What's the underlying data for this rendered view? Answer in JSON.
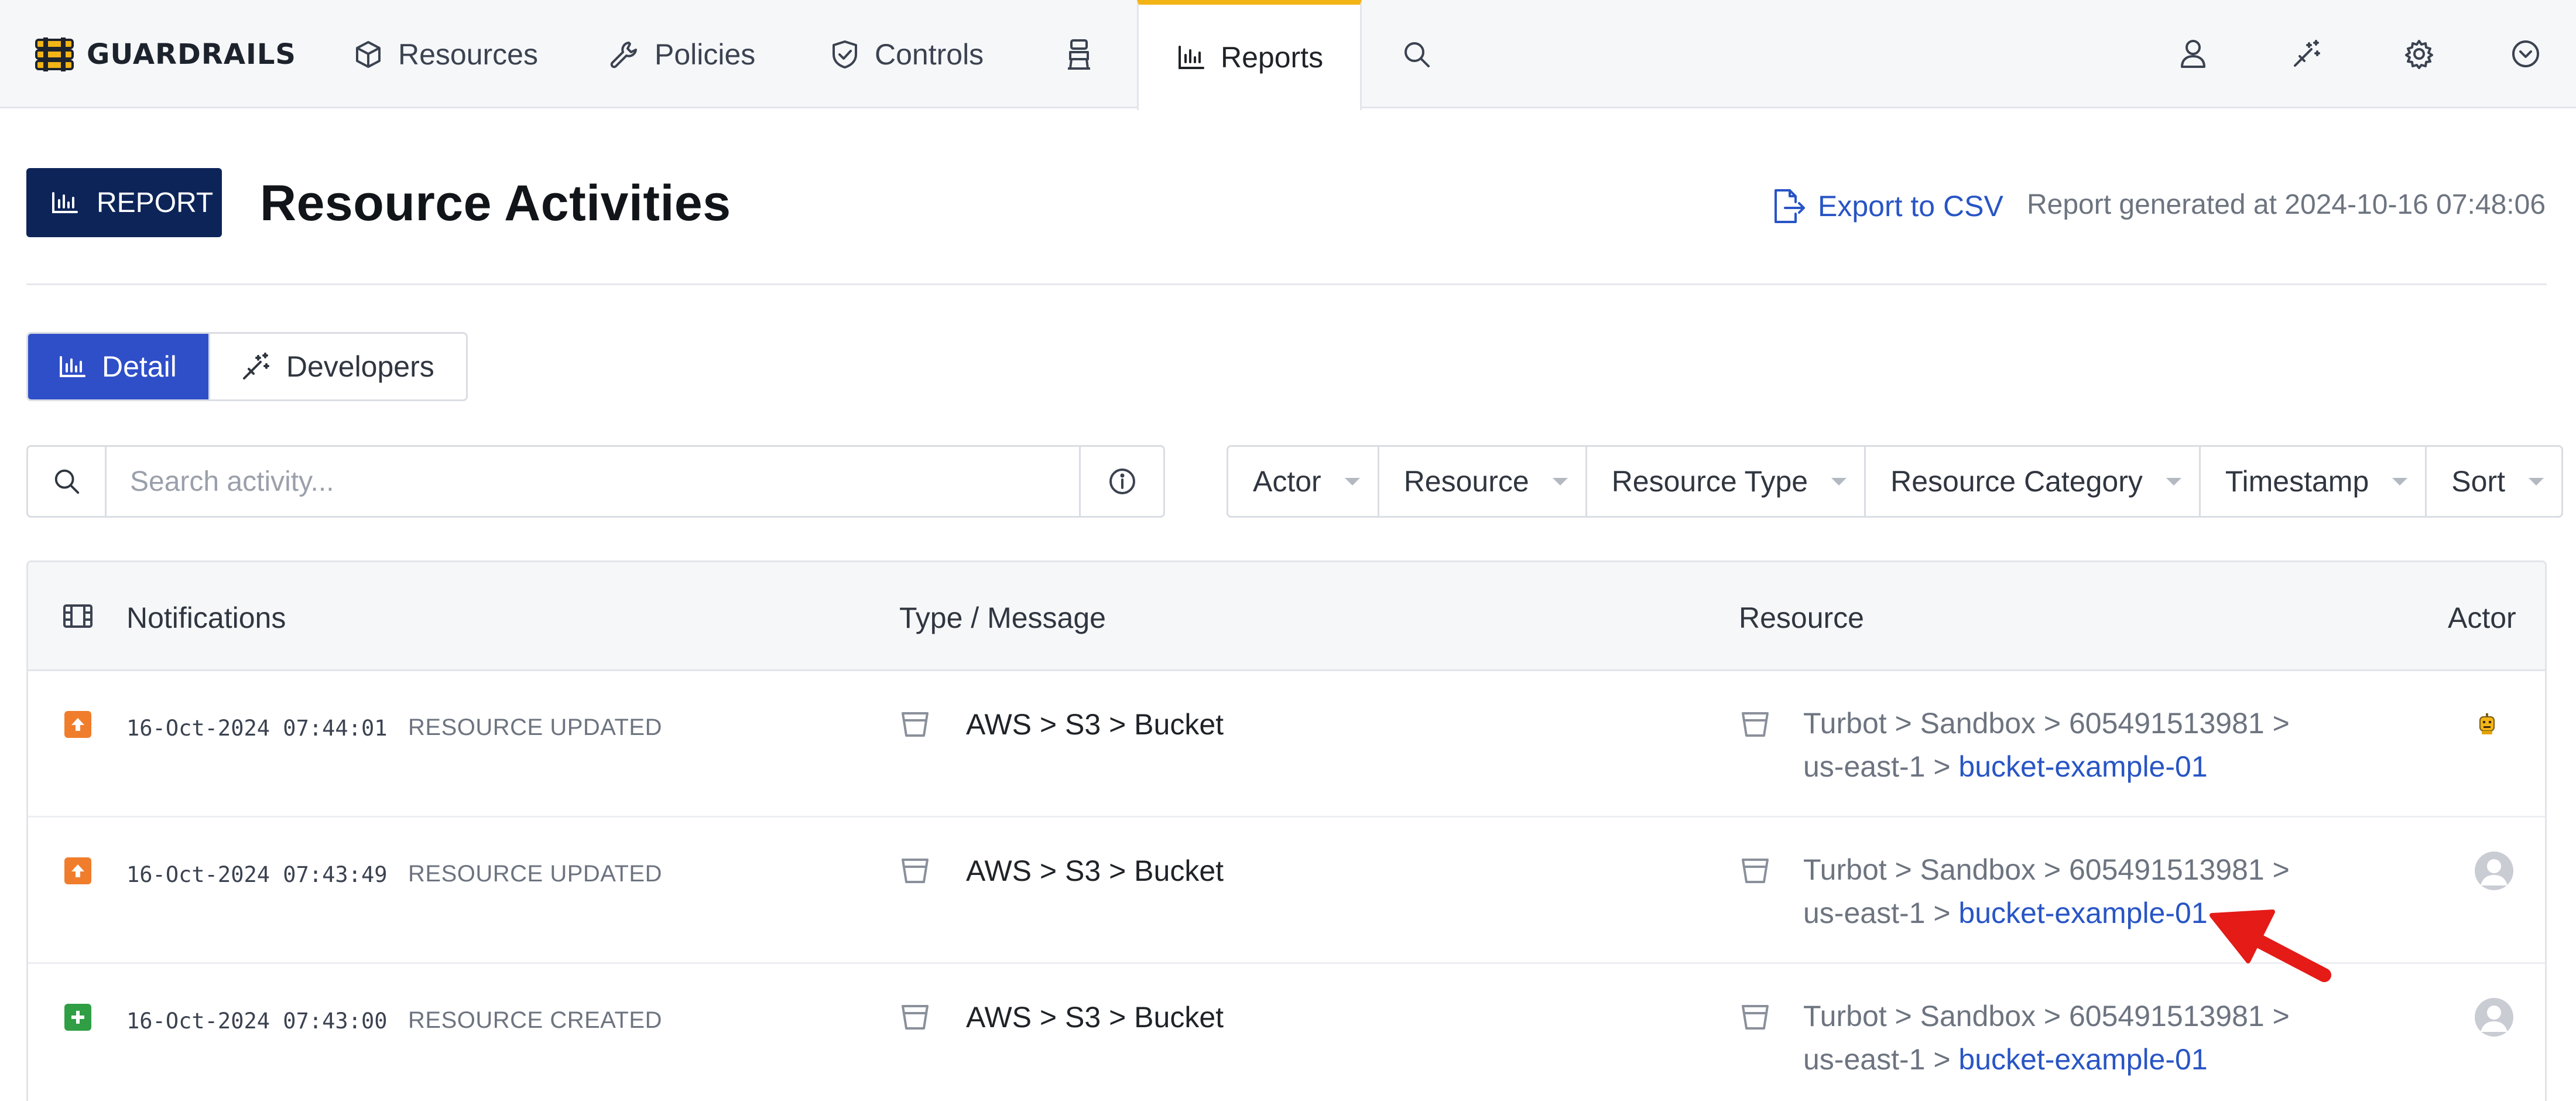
{
  "app": {
    "name": "GUARDRAILS"
  },
  "nav": {
    "items": [
      {
        "label": "Resources",
        "icon": "cube-icon"
      },
      {
        "label": "Policies",
        "icon": "wrench-icon"
      },
      {
        "label": "Controls",
        "icon": "shield-check-icon"
      },
      {
        "label": "",
        "icon": "agent-icon"
      },
      {
        "label": "Reports",
        "icon": "bar-chart-icon",
        "active": true
      },
      {
        "label": "",
        "icon": "search-icon"
      }
    ],
    "right_icons": [
      "user-icon",
      "magic-wand-icon",
      "gear-icon",
      "chevron-down-circle-icon"
    ]
  },
  "header": {
    "badge": "REPORT",
    "title": "Resource Activities",
    "export_label": "Export to CSV",
    "generated": "Report generated at 2024-10-16 07:48:06"
  },
  "tabs": {
    "detail": "Detail",
    "developers": "Developers"
  },
  "search": {
    "placeholder": "Search activity..."
  },
  "filters": [
    "Actor",
    "Resource",
    "Resource Type",
    "Resource Category",
    "Timestamp",
    "Sort"
  ],
  "table": {
    "columns": {
      "notifications": "Notifications",
      "type": "Type / Message",
      "resource": "Resource",
      "actor": "Actor"
    },
    "rows": [
      {
        "status": "updated",
        "status_color": "#f07d2c",
        "timestamp": "16-Oct-2024 07:44:01",
        "event": "RESOURCE UPDATED",
        "type": "AWS > S3 > Bucket",
        "path_line1": "Turbot > Sandbox > 605491513981 >",
        "path_line2_prefix": "us-east-1 > ",
        "resource_link": "bucket-example-01",
        "actor": "bot-avatar"
      },
      {
        "status": "updated",
        "status_color": "#f07d2c",
        "timestamp": "16-Oct-2024 07:43:49",
        "event": "RESOURCE UPDATED",
        "type": "AWS > S3 > Bucket",
        "path_line1": "Turbot > Sandbox > 605491513981 >",
        "path_line2_prefix": "us-east-1 > ",
        "resource_link": "bucket-example-01",
        "actor": "user-avatar"
      },
      {
        "status": "created",
        "status_color": "#2f9e44",
        "timestamp": "16-Oct-2024 07:43:00",
        "event": "RESOURCE CREATED",
        "type": "AWS > S3 > Bucket",
        "path_line1": "Turbot > Sandbox > 605491513981 >",
        "path_line2_prefix": "us-east-1 > ",
        "resource_link": "bucket-example-01",
        "actor": "user-avatar"
      }
    ]
  },
  "colors": {
    "brand": "#0c2458",
    "accent": "#2f4fc9",
    "link": "#2855c5",
    "nav_active": "#f3b416"
  }
}
